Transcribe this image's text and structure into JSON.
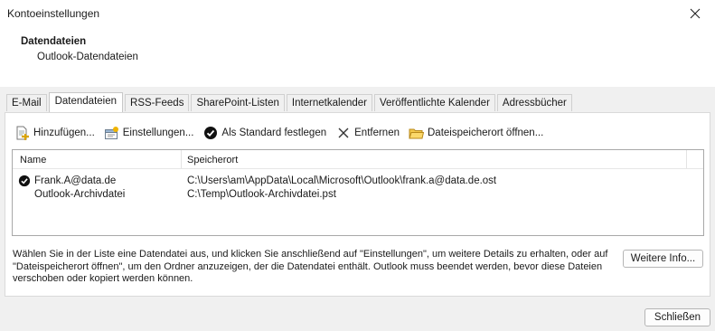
{
  "window": {
    "title": "Kontoeinstellungen"
  },
  "header": {
    "title": "Datendateien",
    "subtitle": "Outlook-Datendateien"
  },
  "tabs": [
    {
      "label": "E-Mail"
    },
    {
      "label": "Datendateien"
    },
    {
      "label": "RSS-Feeds"
    },
    {
      "label": "SharePoint-Listen"
    },
    {
      "label": "Internetkalender"
    },
    {
      "label": "Veröffentlichte Kalender"
    },
    {
      "label": "Adressbücher"
    }
  ],
  "toolbar": {
    "add": "Hinzufügen...",
    "settings": "Einstellungen...",
    "set_default": "Als Standard festlegen",
    "remove": "Entfernen",
    "open_location": "Dateispeicherort öffnen..."
  },
  "list": {
    "columns": [
      "Name",
      "Speicherort"
    ],
    "rows": [
      {
        "name": "Frank.A@data.de",
        "location": "C:\\Users\\am\\AppData\\Local\\Microsoft\\Outlook\\frank.a@data.de.ost",
        "default": true
      },
      {
        "name": "Outlook-Archivdatei",
        "location": "C:\\Temp\\Outlook-Archivdatei.pst",
        "default": false
      }
    ]
  },
  "description": "Wählen Sie in der Liste eine Datendatei aus, und klicken Sie anschließend auf \"Einstellungen\", um weitere Details zu erhalten, oder auf \"Dateispeicherort öffnen\", um den Ordner anzuzeigen, der die Datendatei enthält. Outlook muss beendet werden, bevor diese Dateien verschoben oder kopiert werden können.",
  "buttons": {
    "more_info": "Weitere Info...",
    "close": "Schließen"
  }
}
